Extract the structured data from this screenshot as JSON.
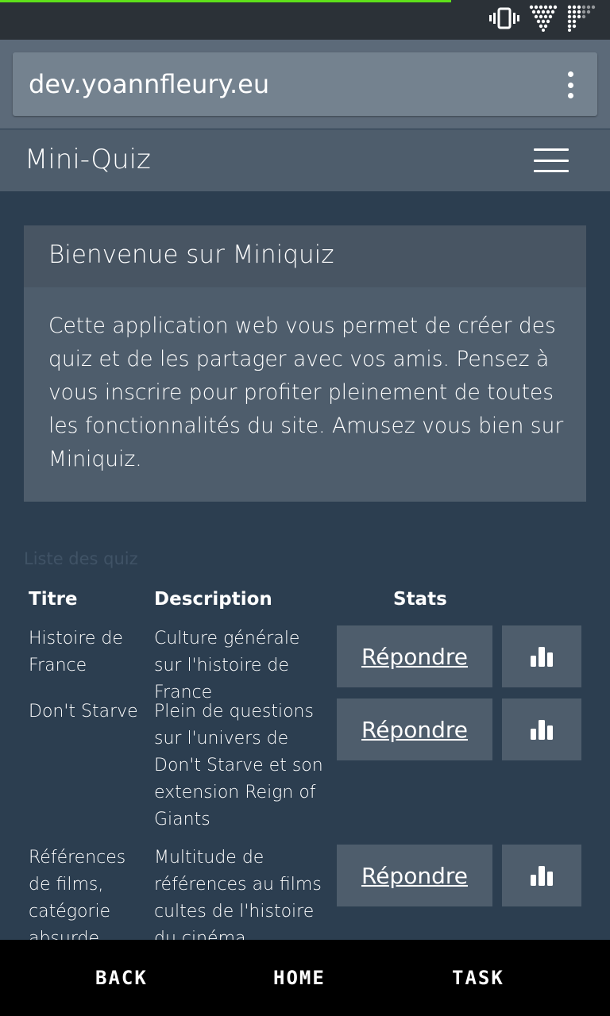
{
  "browser": {
    "url": "dev.yoannfleury.eu",
    "load_progress": 0.74
  },
  "navbar": {
    "brand": "Mini-Quiz"
  },
  "welcome": {
    "title": "Bienvenue sur Miniquiz",
    "body": "Cette application web vous permet de créer des quiz et de les partager avec vos amis. Pensez à vous inscrire pour profiter pleinement de toutes les fonctionnalités du site. Amusez vous bien sur Miniquiz."
  },
  "quiz_table": {
    "caption": "Liste des quiz",
    "headers": {
      "title": "Titre",
      "description": "Description",
      "stats": "Stats"
    },
    "rows": [
      {
        "title": "Histoire de France",
        "description": "Culture générale sur l'histoire de France",
        "answer_label": "Répondre"
      },
      {
        "title": "Don't Starve",
        "description": "Plein de questions sur l'univers de Don't Starve et son extension Reign of Giants",
        "answer_label": "Répondre"
      },
      {
        "title": "Références de films, catégorie absurde",
        "description": "Multitude de références au films cultes de l'histoire du cinéma",
        "answer_label": "Répondre"
      }
    ]
  },
  "bottom_nav": {
    "back": "BACK",
    "home": "HOME",
    "task": "TASK"
  },
  "colors": {
    "background": "#2c3e50",
    "panel": "#4e5d6c",
    "progress": "#5ee01a"
  },
  "icons": [
    "vibrate-icon",
    "signal-icon",
    "wifi-icon",
    "menu-dots-icon",
    "hamburger-icon",
    "bar-chart-icon"
  ]
}
